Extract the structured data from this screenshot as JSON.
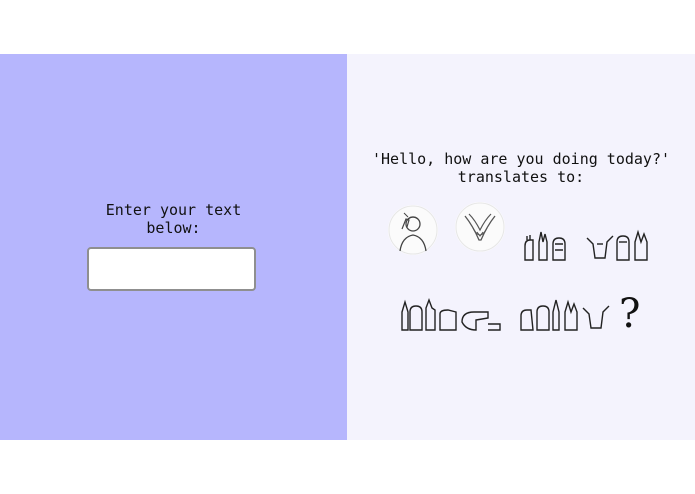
{
  "input_panel": {
    "prompt": "Enter your text\nbelow:",
    "input_value": "",
    "input_placeholder": ""
  },
  "output_panel": {
    "heading_line1": "'Hello, how are you doing today?'",
    "heading_line2": "translates to:",
    "punctuation": "?"
  },
  "colors": {
    "left_bg": "#b6b6fd",
    "right_bg": "#f4f3fd"
  }
}
